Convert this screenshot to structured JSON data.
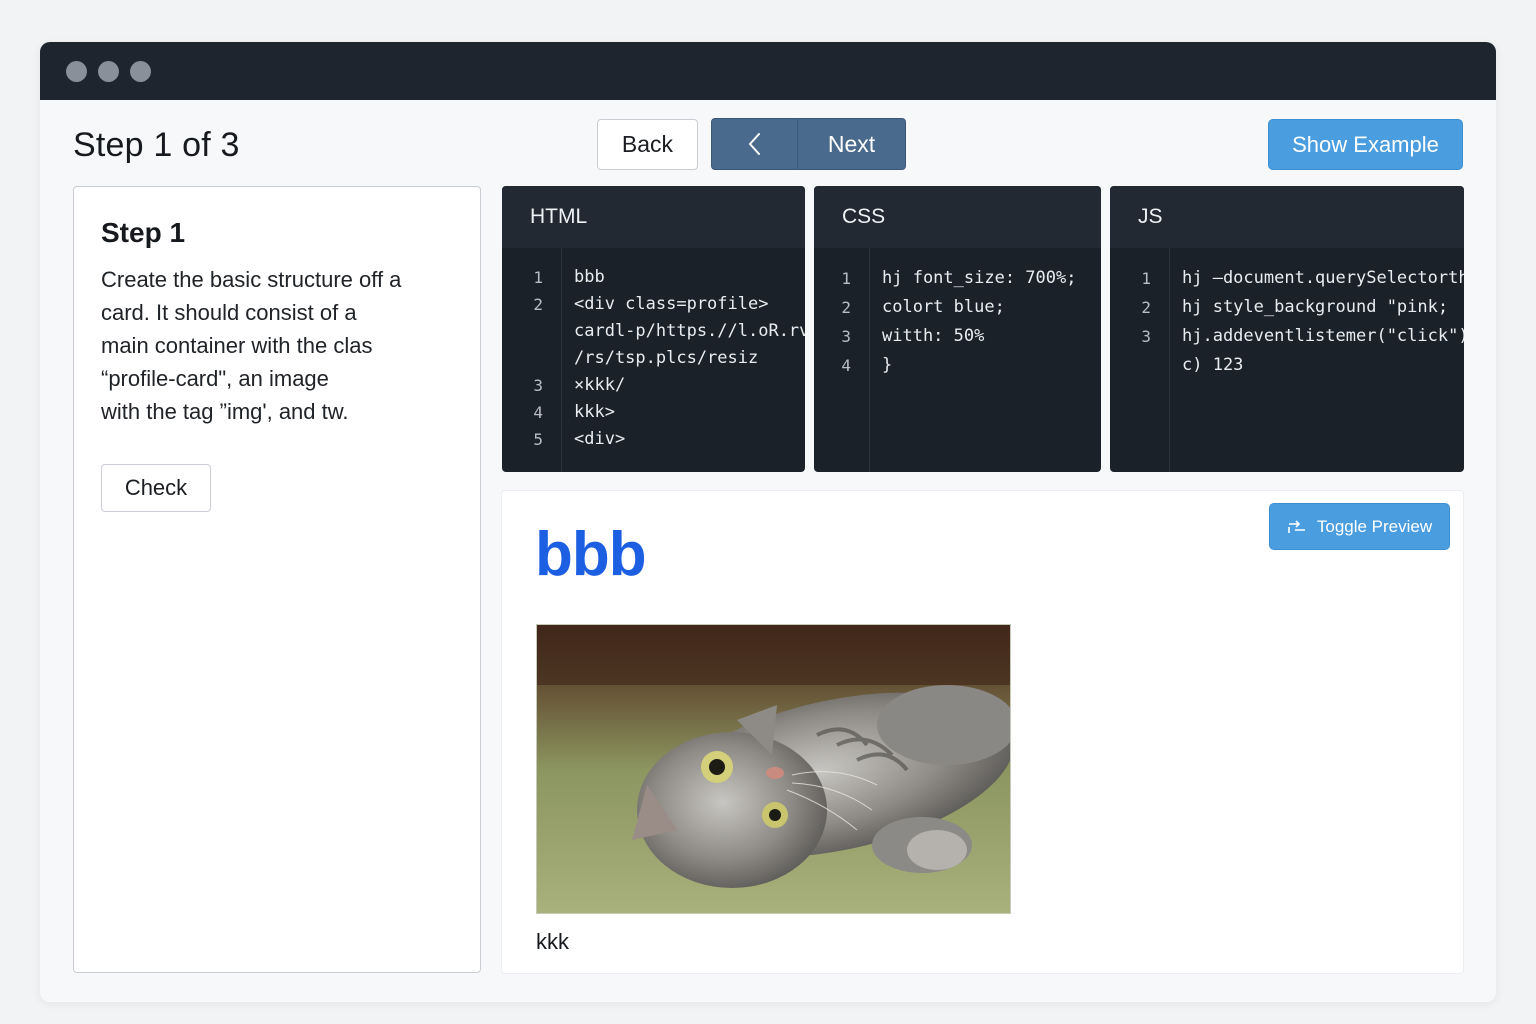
{
  "header": {
    "step_title": "Step 1 of 3",
    "back_label": "Back",
    "next_label": "Next",
    "show_example_label": "Show Example"
  },
  "instructions": {
    "heading": "Step 1",
    "body": "Create the basic structure off a\ncard. It should consist of a\nmain container with the clas\n“profile-card\", an image\nwith the tag ”img', and tw.",
    "check_label": "Check"
  },
  "editors": {
    "html": {
      "title": "HTML",
      "line_numbers": [
        "1",
        "2",
        "",
        "",
        "3",
        "4",
        "5"
      ],
      "lines": [
        "bbb",
        "<div class=profile>",
        "cardl-p/https.//l.oR.rv",
        "/rs/tsp.plcs/resiz",
        "×kkk/",
        "kkk>",
        "<div>"
      ]
    },
    "css": {
      "title": "CSS",
      "line_numbers": [
        "1",
        "2",
        "3",
        "4"
      ],
      "lines": [
        "hj  font_size: 700%;",
        "colort blue;",
        "witth: 50%",
        "}"
      ]
    },
    "js": {
      "title": "JS",
      "line_numbers": [
        "1",
        "2",
        "3",
        ""
      ],
      "lines": [
        "hj –document.querySelectorth\"",
        "hj style_background \"pink;",
        "hj.addeventlistemer(\"click\"),",
        "c) 123"
      ]
    }
  },
  "preview": {
    "heading": "bbb",
    "toggle_label": "Toggle Preview",
    "caption": "kkk"
  },
  "colors": {
    "titlebar": "#1e252e",
    "next_button": "#496a8c",
    "accent_button": "#4a9ee0",
    "preview_heading": "#1d5fe3",
    "code_bg": "#1b2129"
  },
  "icons": {
    "toggle": "swap-arrows-icon",
    "prev": "chevron-left-icon"
  }
}
